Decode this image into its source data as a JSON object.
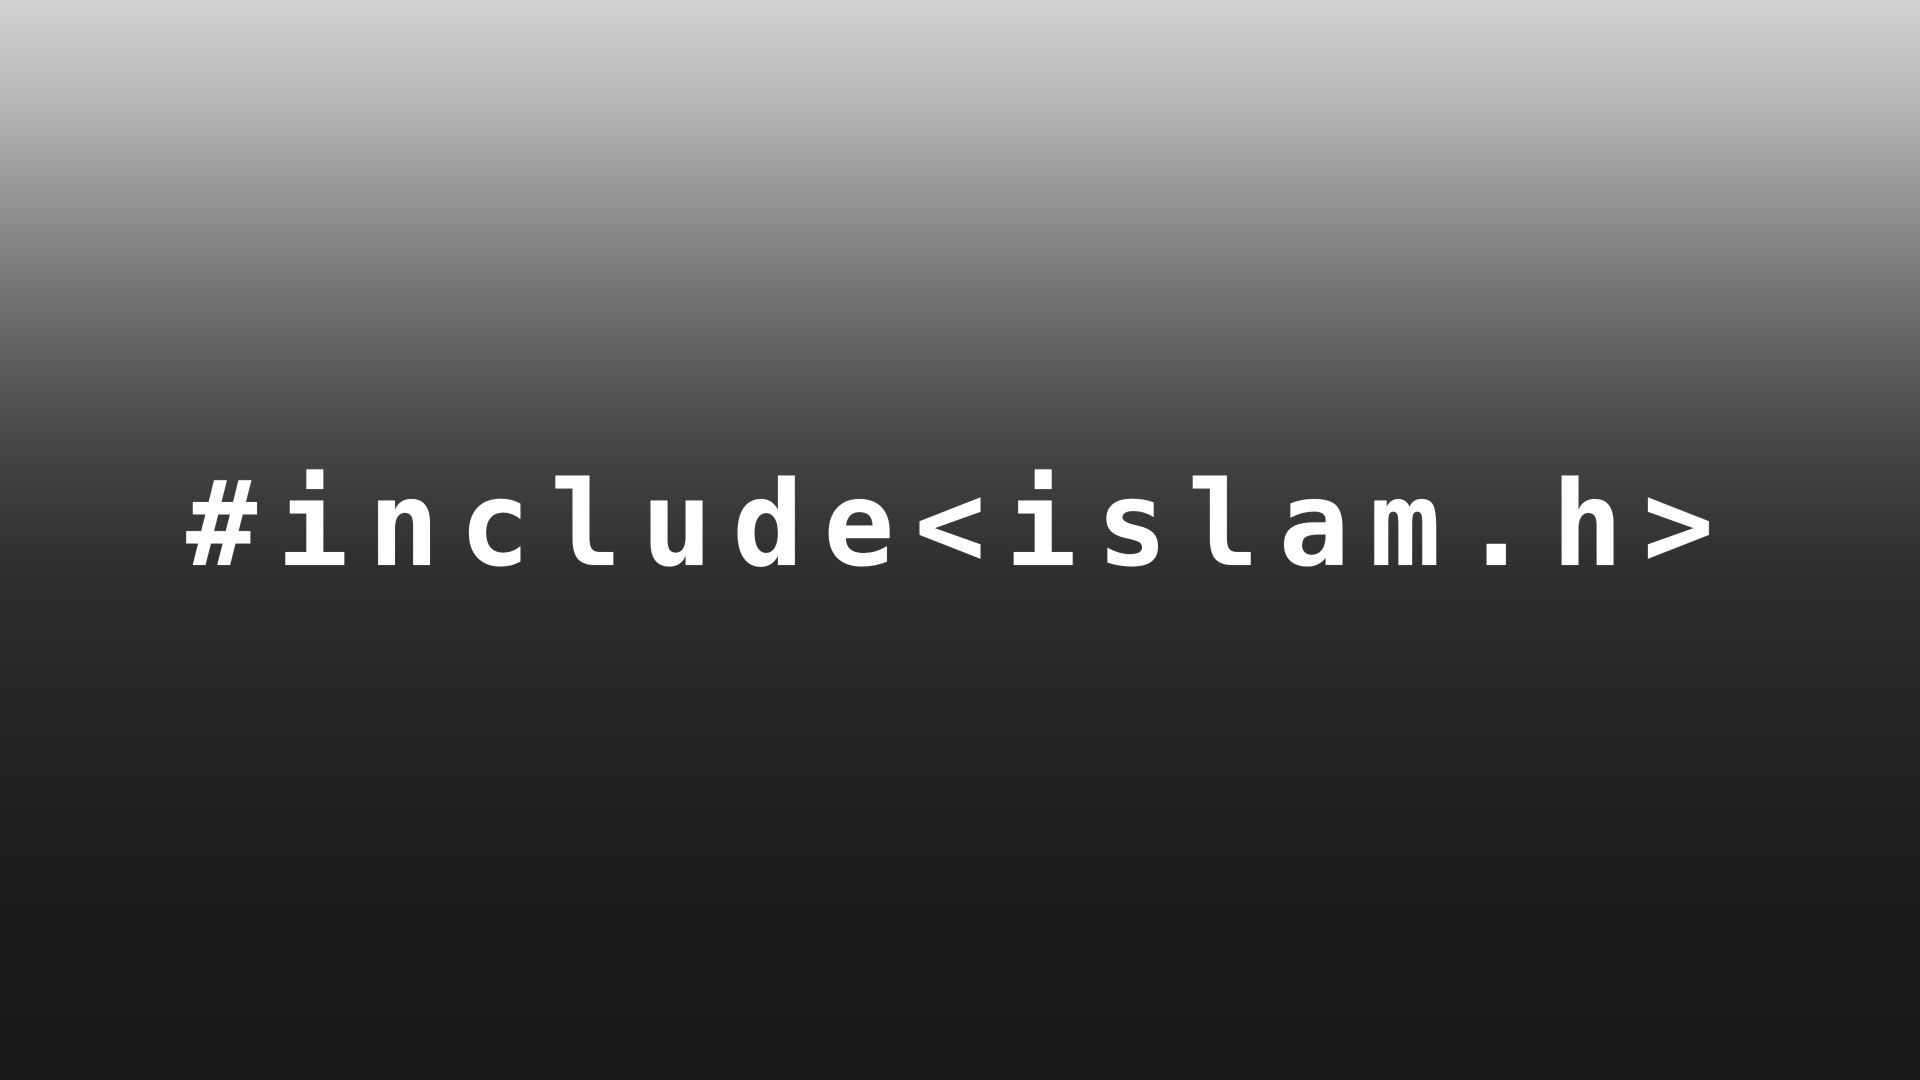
{
  "headline": {
    "text": "#include<islam.h>"
  },
  "colors": {
    "text": "#ffffff",
    "gradient_top": "#d2d2d2",
    "gradient_bottom": "#181818"
  }
}
